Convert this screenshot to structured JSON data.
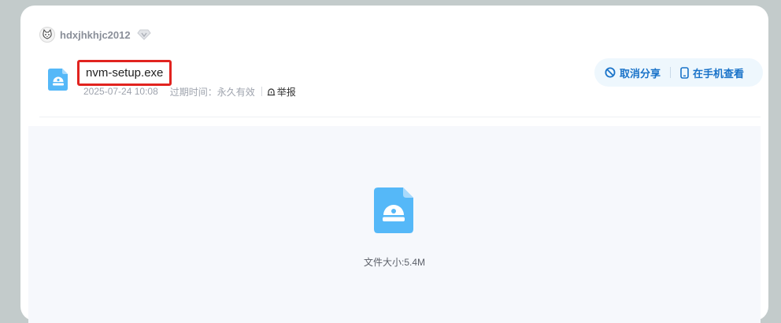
{
  "user": {
    "name": "hdxjhkhjc2012",
    "avatar_icon": "cat-avatar",
    "badge_icon": "diamond-vip-icon"
  },
  "file": {
    "name": "nvm-setup.exe",
    "date": "2025-07-24 10:08",
    "expire_label": "过期时间：",
    "expire_value": "永久有效",
    "report_label": "举报",
    "size_text": "文件大小:5.4M",
    "icon": "installer-file-icon"
  },
  "actions": {
    "cancel_share": "取消分享",
    "view_on_phone": "在手机查看"
  },
  "colors": {
    "accent": "#1a73c9",
    "highlight_border": "#e1231f",
    "file_icon": "#55b8f8",
    "preview_bg": "#f6f8fc"
  }
}
